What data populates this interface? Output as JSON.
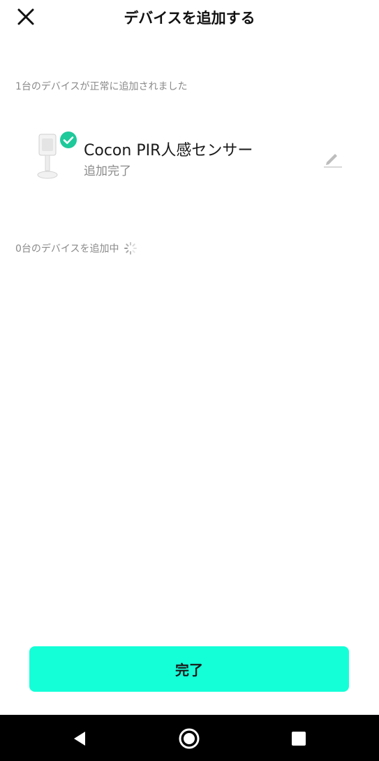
{
  "header": {
    "title": "デバイスを追加する",
    "close_icon": "close-icon"
  },
  "added_section": {
    "label": "1台のデバイスが正常に追加されました",
    "devices": [
      {
        "name": "Cocon PIR人感センサー",
        "status": "追加完了",
        "icon": "motion-sensor-icon",
        "badge": "check-badge-icon"
      }
    ]
  },
  "adding_section": {
    "label": "0台のデバイスを追加中",
    "icon": "loading-spinner-icon"
  },
  "footer": {
    "done_label": "完了"
  },
  "colors": {
    "accent": "#14ffd8",
    "check": "#1ec99a",
    "muted_text": "#8a8a8a"
  },
  "system_nav": {
    "back": "back-icon",
    "home": "home-icon",
    "recent": "recent-apps-icon"
  }
}
